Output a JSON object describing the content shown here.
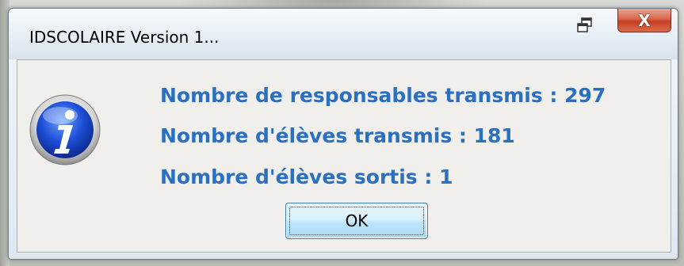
{
  "window": {
    "title": "IDSCOLAIRE Version 1...",
    "close_label": "X",
    "restore_icon": "restore-icon"
  },
  "message": {
    "icon": "info-icon",
    "lines": [
      "Nombre de responsables transmis : 297",
      "Nombre d'élèves transmis : 181",
      "Nombre d'élèves sortis : 1"
    ],
    "color": "#2b6fc0"
  },
  "buttons": {
    "ok_label": "OK"
  }
}
